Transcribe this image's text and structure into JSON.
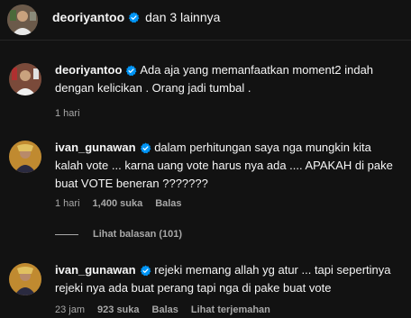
{
  "header": {
    "username": "deoriyantoo",
    "others": "dan 3 lainnya"
  },
  "comments": [
    {
      "username": "deoriyantoo",
      "text": "Ada aja yang memanfaatkan moment2 indah dengan kelicikan . Orang jadi tumbal .",
      "time": "1 hari"
    },
    {
      "username": "ivan_gunawan",
      "text": "dalam perhitungan saya nga mungkin kita kalah vote ... karna uang vote harus nya ada .... APAKAH di pake buat VOTE beneran ???????",
      "time": "1 hari",
      "likes": "1,400 suka",
      "reply": "Balas",
      "view_replies": "Lihat balasan (101)"
    },
    {
      "username": "ivan_gunawan",
      "text": "rejeki memang allah yg atur ... tapi sepertinya rejeki nya ada buat perang tapi nga di pake buat vote",
      "time": "23 jam",
      "likes": "923 suka",
      "reply": "Balas",
      "translate": "Lihat terjemahan"
    }
  ],
  "colors": {
    "background": "#121212",
    "text": "#f5f5f5",
    "muted": "#a8a8a8",
    "verified": "#0095f6"
  },
  "icons": [
    "verified-badge-icon",
    "avatar"
  ]
}
